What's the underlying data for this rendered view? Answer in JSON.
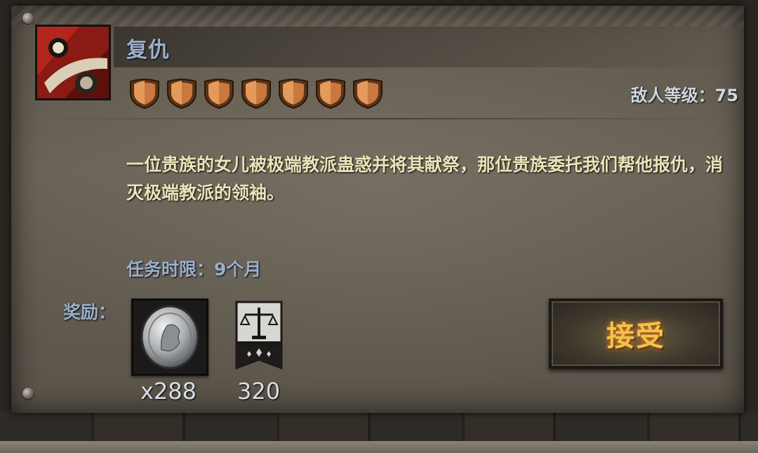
{
  "quest": {
    "title": "复仇",
    "icon": "quest-emblem-icon",
    "difficulty_shields": 7,
    "enemy_level_label": "敌人等级：75",
    "description": "一位贵族的女儿被极端教派蛊惑并将其献祭，那位贵族委托我们帮他报仇，消灭极端教派的领袖。",
    "time_limit_label": "任务时限：9个月"
  },
  "rewards": {
    "label": "奖励：",
    "items": [
      {
        "icon": "silver-coin-icon",
        "count": "x288"
      },
      {
        "icon": "justice-banner-icon",
        "count": "320"
      }
    ]
  },
  "actions": {
    "accept_label": "接受"
  },
  "colors": {
    "title_blue": "#9ab0cc",
    "description_cream": "#e9e4b8",
    "accept_gold": "#f2c24a"
  }
}
